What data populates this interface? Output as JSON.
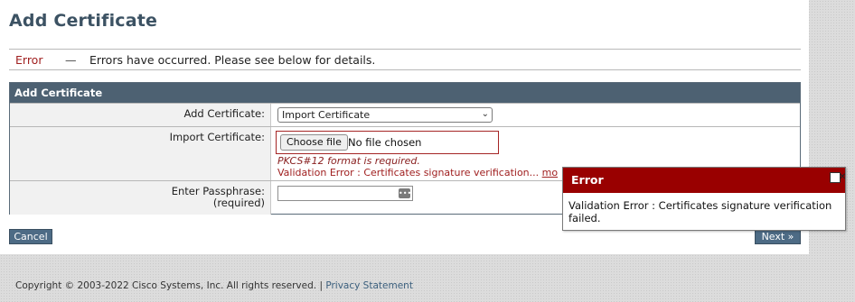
{
  "page": {
    "title": "Add Certificate"
  },
  "error_bar": {
    "label": "Error",
    "separator": "—",
    "message": "Errors have occurred. Please see below for details."
  },
  "form": {
    "header": "Add Certificate",
    "add_certificate": {
      "label": "Add Certificate:",
      "selected": "Import Certificate"
    },
    "import_certificate": {
      "label": "Import Certificate:",
      "choose_button": "Choose file",
      "file_status": "No file chosen",
      "hint": "PKCS#12 format is required.",
      "validation_error": "Validation Error : Certificates signature verification...",
      "more_link": "mo"
    },
    "passphrase": {
      "label_line1": "Enter Passphrase:",
      "label_line2": "(required)",
      "value": ""
    }
  },
  "buttons": {
    "cancel": "Cancel",
    "next": "Next »"
  },
  "error_popup": {
    "title": "Error",
    "close_glyph": "✕",
    "message": "Validation Error : Certificates signature verification failed."
  },
  "footer": {
    "copyright": "Copyright © 2003-2022 Cisco Systems, Inc. All rights reserved. |",
    "privacy_link": "Privacy Statement"
  },
  "colors": {
    "title": "#3c5263",
    "header_bg": "#4d6172",
    "error_text": "#a02020",
    "popup_header": "#990000",
    "button_bg": "#4d6b85"
  }
}
